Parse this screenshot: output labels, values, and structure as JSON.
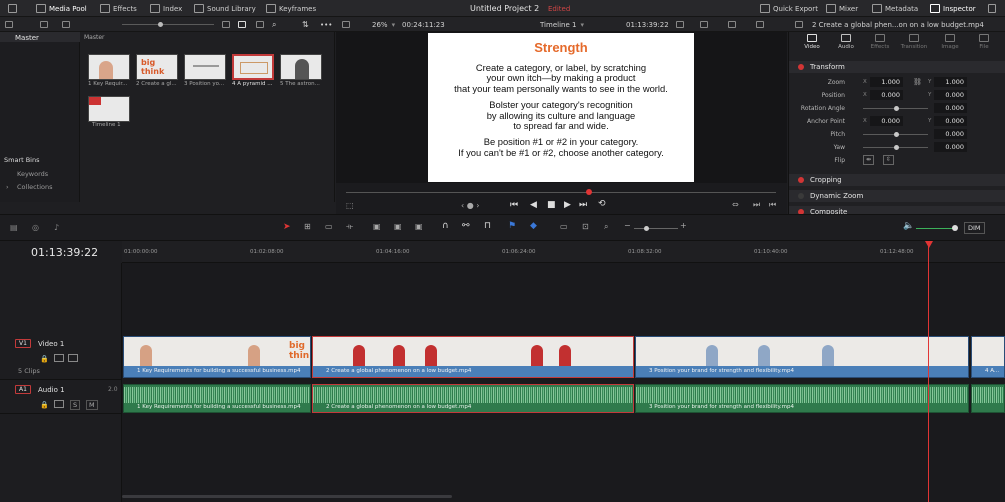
{
  "topbar": {
    "media_pool": "Media Pool",
    "effects": "Effects",
    "index": "Index",
    "sound_library": "Sound Library",
    "keyframes": "Keyframes",
    "project_title": "Untitled Project 2",
    "edited": "Edited",
    "quick_export": "Quick Export",
    "mixer": "Mixer",
    "metadata": "Metadata",
    "inspector": "Inspector"
  },
  "viewer_bar": {
    "zoom": "26%",
    "source_tc": "00:24:11:23",
    "timeline_name": "Timeline 1",
    "record_tc": "01:13:39:22",
    "clip_title": "2 Create a global phen...on on a low budget.mp4"
  },
  "bins": {
    "header": "Master",
    "master_item": "Master",
    "smart_bins": "Smart Bins",
    "keywords": "Keywords",
    "collections": "Collections"
  },
  "pool": {
    "header": "Master",
    "items": [
      {
        "label": "1 Key Requir...",
        "thumb_text": ""
      },
      {
        "label": "2 Create a gl...",
        "thumb_text": "big think"
      },
      {
        "label": "3 Position yo...",
        "thumb_text": ""
      },
      {
        "label": "4 A pyramid ...",
        "thumb_text": ""
      },
      {
        "label": "5 The astron...",
        "thumb_text": ""
      },
      {
        "label": "Timeline 1",
        "thumb_text": ""
      }
    ]
  },
  "slide": {
    "title": "Strength",
    "lines": [
      "Create a category, or label, by scratching",
      "your own itch—by making a product",
      "that your team personally wants to see in the world.",
      "Bolster your category's recognition",
      "by allowing its culture and language",
      "to spread far and wide.",
      "Be position #1 or #2 in your category.",
      "If you can't be #1 or #2, choose another category."
    ]
  },
  "inspector": {
    "tabs": [
      "Video",
      "Audio",
      "Effects",
      "Transition",
      "Image",
      "File"
    ],
    "transform": "Transform",
    "zoom_label": "Zoom",
    "zoom_x": "1.000",
    "zoom_y": "1.000",
    "position_label": "Position",
    "position_x": "0.000",
    "position_y": "0.000",
    "rotation_label": "Rotation Angle",
    "rotation": "0.000",
    "anchor_label": "Anchor Point",
    "anchor_x": "0.000",
    "anchor_y": "0.000",
    "pitch_label": "Pitch",
    "pitch": "0.000",
    "yaw_label": "Yaw",
    "yaw": "0.000",
    "flip_label": "Flip",
    "x": "X",
    "y": "Y",
    "cropping": "Cropping",
    "dynamic_zoom": "Dynamic Zoom",
    "composite": "Composite"
  },
  "timeline": {
    "timecode": "01:13:39:22",
    "ruler": [
      "01:00:00:00",
      "01:02:08:00",
      "01:04:16:00",
      "01:06:24:00",
      "01:08:32:00",
      "01:10:40:00",
      "01:12:48:00"
    ],
    "dim": "DIM",
    "v1_tag": "V1",
    "v1_name": "Video 1",
    "clips_count": "5 Clips",
    "a1_tag": "A1",
    "a1_name": "Audio 1",
    "a1_channels": "2.0",
    "solo": "S",
    "mute": "M",
    "clips": [
      "1 Key Requirements for building a successful business.mp4",
      "2 Create a global phenomenon on a low budget.mp4",
      "3 Position your brand for strength and flexibility.mp4",
      "4 A..."
    ]
  }
}
